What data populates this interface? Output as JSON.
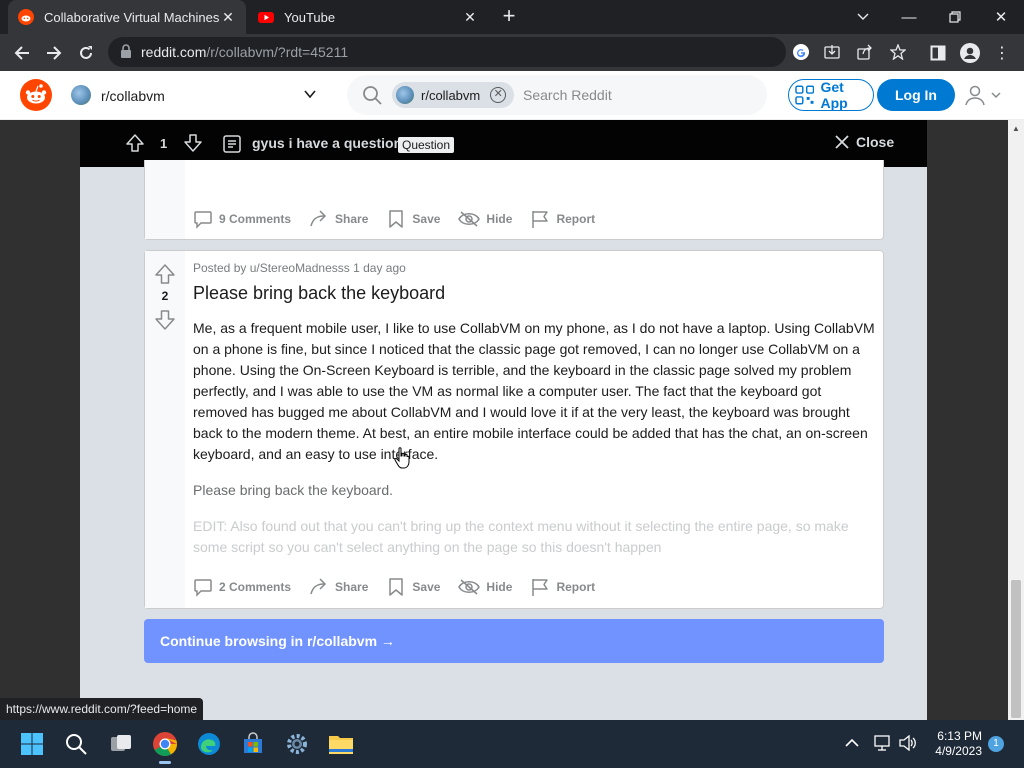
{
  "browser": {
    "tabs": [
      {
        "title": "Collaborative Virtual Machines!",
        "active": true,
        "favicon": "reddit-icon"
      },
      {
        "title": "YouTube",
        "active": false,
        "favicon": "youtube-icon"
      }
    ],
    "url_domain": "reddit.com",
    "url_path": "/r/collabvm/?rdt=45211",
    "status_url": "https://www.reddit.com/?feed=home"
  },
  "header": {
    "community": "r/collabvm",
    "search_chip": "r/collabvm",
    "search_placeholder": "Search Reddit",
    "get_app_label": "Get App",
    "login_label": "Log In"
  },
  "post_bar": {
    "vote_count": "1",
    "title": "gyus i have a question",
    "flair": "Question",
    "close_label": "Close"
  },
  "prev_card": {
    "comments": "9 Comments",
    "share": "Share",
    "save": "Save",
    "hide": "Hide",
    "report": "Report"
  },
  "post": {
    "meta": "Posted by u/StereoMadnesss 1 day ago",
    "votes": "2",
    "title": "Please bring back the keyboard",
    "body": [
      "Me, as a frequent mobile user, I like to use CollabVM on my phone, as I do not have a laptop. Using CollabVM on a phone is fine, but since I noticed that the classic page got removed, I can no longer use CollabVM on a phone. Using the On-Screen Keyboard is terrible, and the keyboard in the classic page solved my problem perfectly, and I was able to use the VM as normal like a computer user. The fact that the keyboard got removed has bugged me about CollabVM and I would love it if at the very least, the keyboard was brought back to the modern theme. At best, an entire mobile interface could be added that has the chat, an on-screen keyboard, and an easy to use interface.",
      "Please bring back the keyboard.",
      "EDIT: Also found out that you can't bring up the context menu without it selecting the entire page, so make some script so you can't select anything on the page so this doesn't happen"
    ],
    "comments": "2 Comments",
    "share": "Share",
    "save": "Save",
    "hide": "Hide",
    "report": "Report"
  },
  "continue_label": "Continue browsing in r/collabvm →",
  "taskbar": {
    "time": "6:13 PM",
    "date": "4/9/2023",
    "notification_count": "1"
  },
  "colors": {
    "reddit_orange": "#ff4500",
    "reddit_blue": "#0079d3",
    "continue_blue": "#7193ff"
  }
}
